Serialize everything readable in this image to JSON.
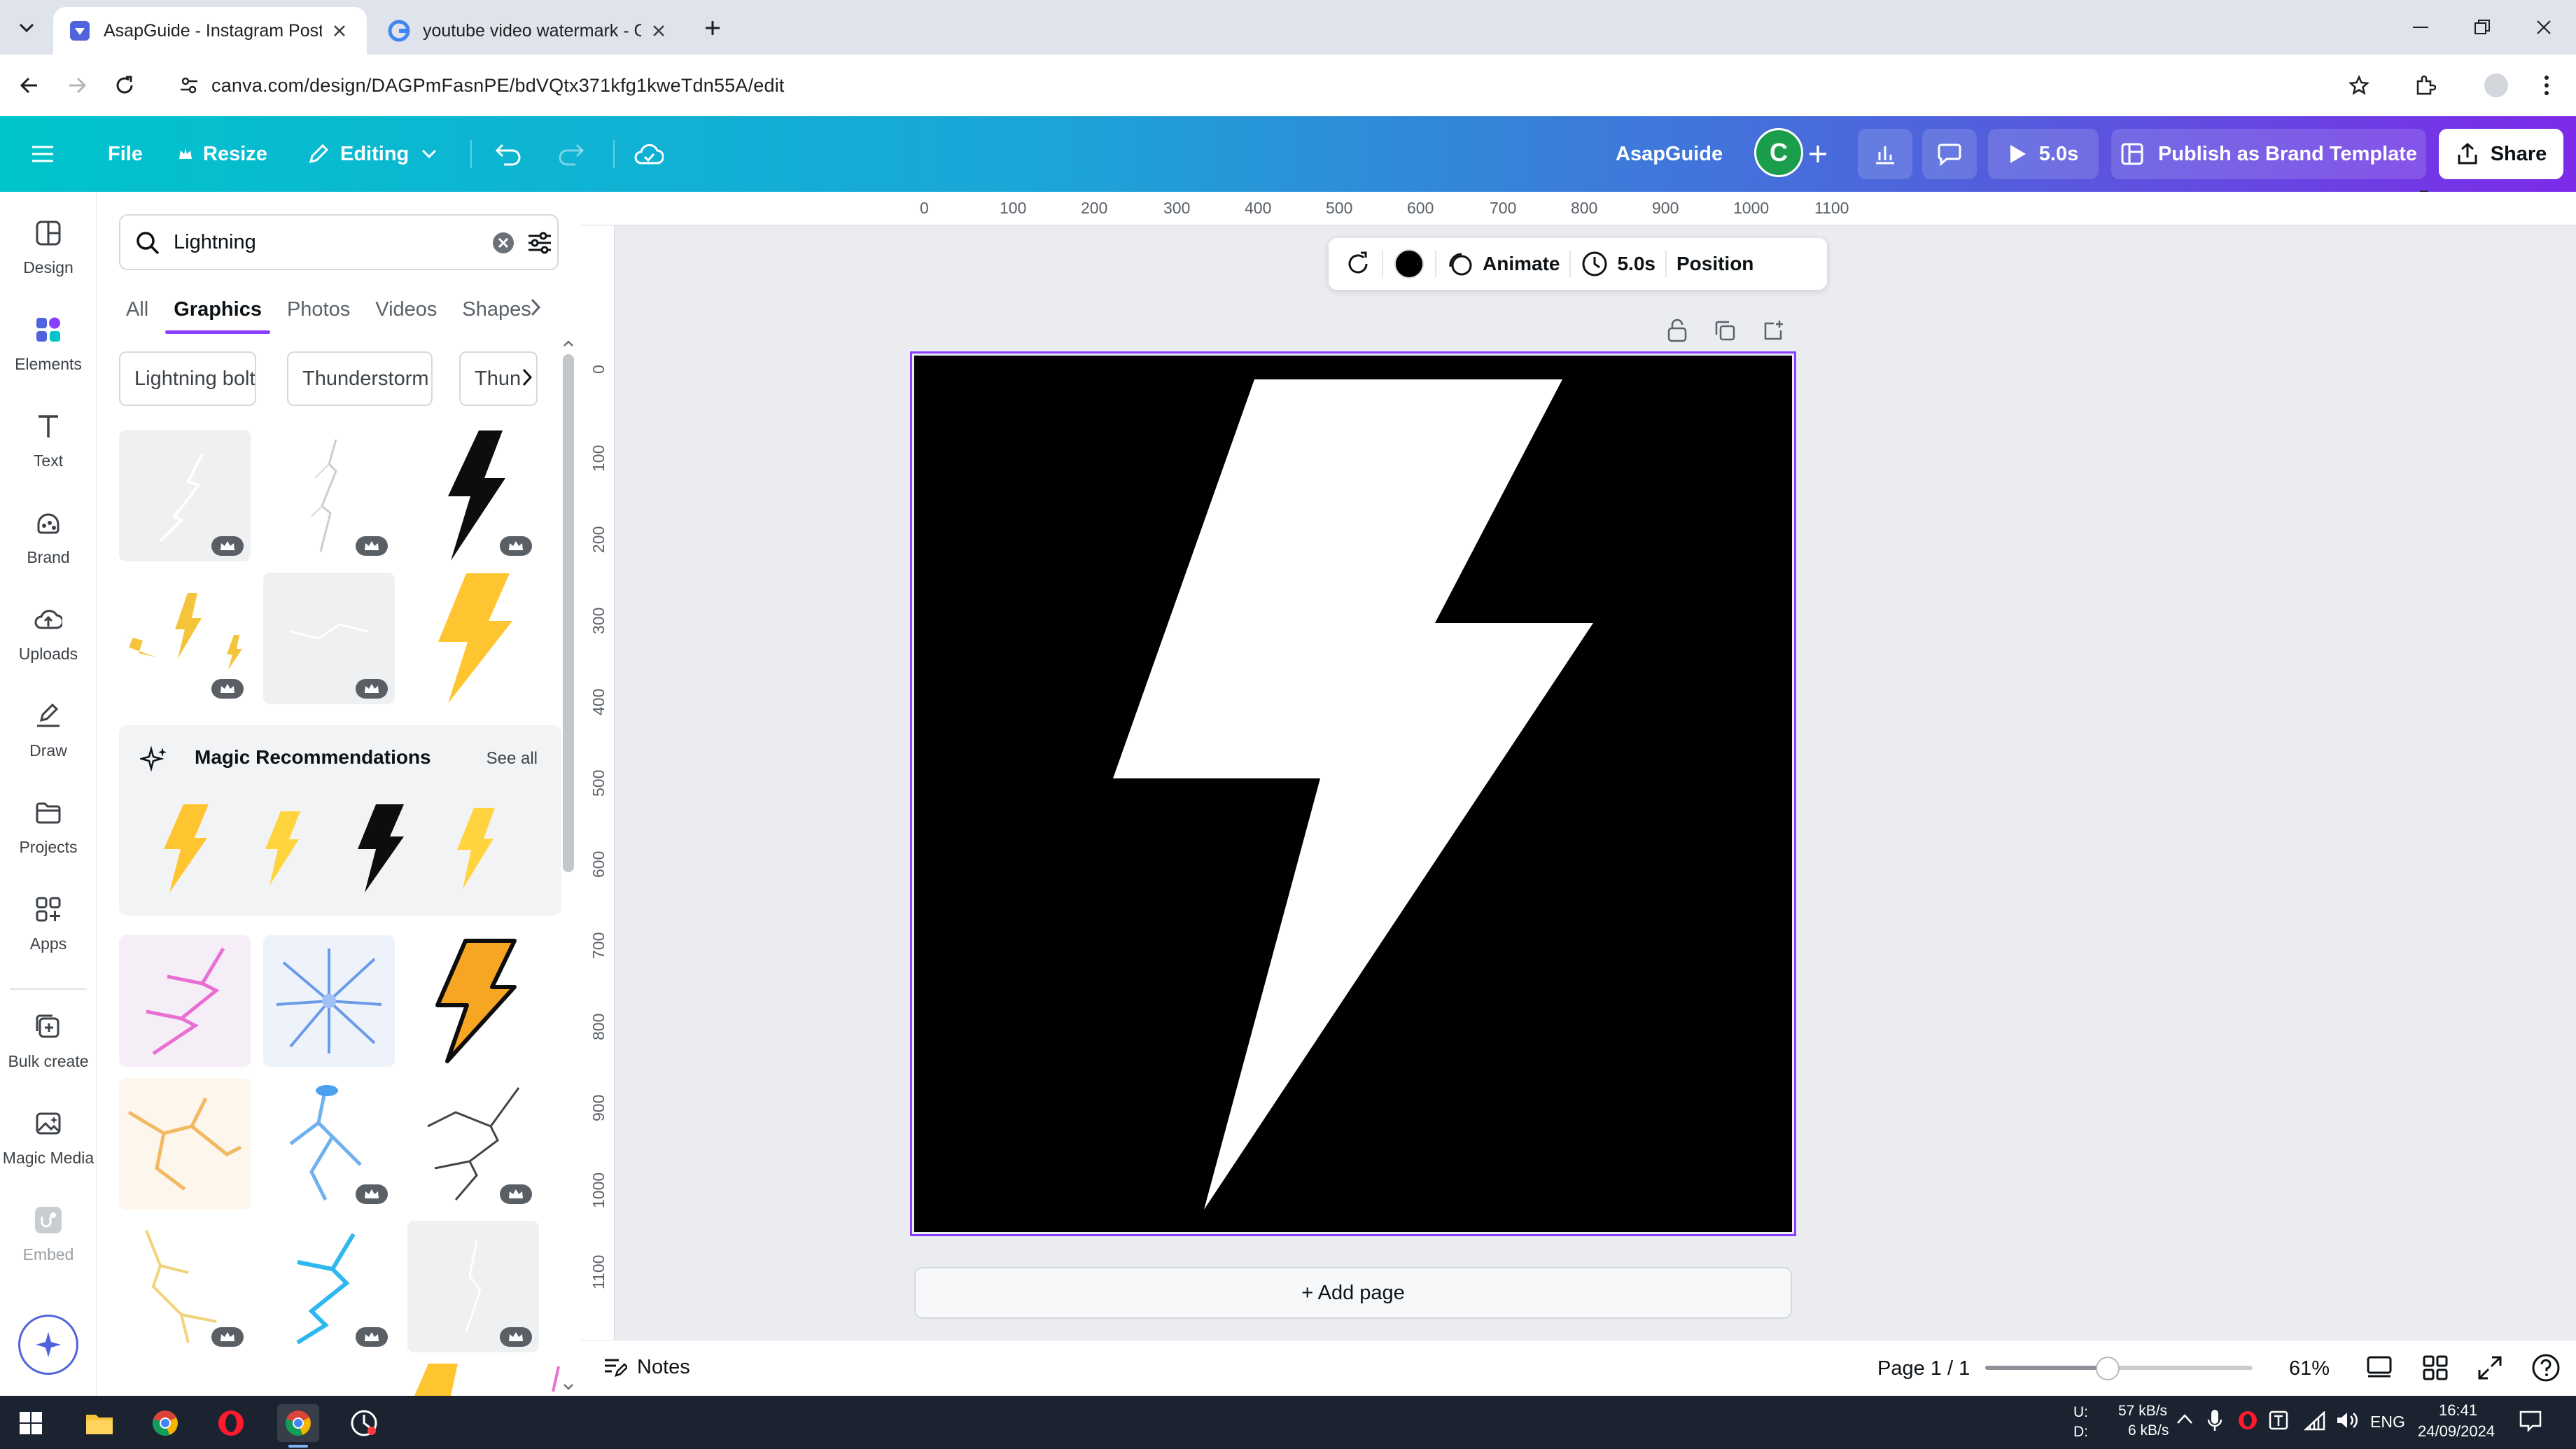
{
  "browser": {
    "tabs": [
      {
        "title": "AsapGuide - Instagram Post - C",
        "active": true,
        "icon": "canva-favicon"
      },
      {
        "title": "youtube video watermark - Go",
        "active": false,
        "icon": "google-favicon"
      }
    ],
    "url": "canva.com/design/DAGPmFasnPE/bdVQtx371kfg1kweTdn55A/edit"
  },
  "header": {
    "file": "File",
    "resize": "Resize",
    "editing": "Editing",
    "brand_name": "AsapGuide",
    "avatar_letter": "C",
    "timer": "5.0s",
    "publish": "Publish as Brand Template",
    "share": "Share"
  },
  "rail": {
    "items": [
      {
        "label": "Design",
        "icon": "design-icon"
      },
      {
        "label": "Elements",
        "icon": "elements-icon"
      },
      {
        "label": "Text",
        "icon": "text-icon"
      },
      {
        "label": "Brand",
        "icon": "brand-icon"
      },
      {
        "label": "Uploads",
        "icon": "uploads-icon"
      },
      {
        "label": "Draw",
        "icon": "draw-icon"
      },
      {
        "label": "Projects",
        "icon": "projects-icon"
      },
      {
        "label": "Apps",
        "icon": "apps-icon"
      },
      {
        "label": "Bulk create",
        "icon": "bulk-create-icon"
      },
      {
        "label": "Magic Media",
        "icon": "magic-media-icon"
      },
      {
        "label": "Embed",
        "icon": "embed-icon"
      }
    ]
  },
  "panel": {
    "search_value": "Lightning",
    "tabs": [
      "All",
      "Graphics",
      "Photos",
      "Videos",
      "Shapes"
    ],
    "active_tab": "Graphics",
    "chips": [
      "Lightning bolt",
      "Thunderstorm",
      "Thun"
    ],
    "magic_title": "Magic Recommendations",
    "see_all": "See all"
  },
  "toolbar": {
    "animate": "Animate",
    "duration": "5.0s",
    "position": "Position",
    "color": "#000000"
  },
  "rulers": {
    "h": [
      "0",
      "100",
      "200",
      "300",
      "400",
      "500",
      "600",
      "700",
      "800",
      "900",
      "1000",
      "1100"
    ],
    "v": [
      "0",
      "100",
      "200",
      "300",
      "400",
      "500",
      "600",
      "700",
      "800",
      "900",
      "1000",
      "1100"
    ]
  },
  "canvas": {
    "background": "#000000",
    "add_page": "+ Add page"
  },
  "footer": {
    "notes": "Notes",
    "page": "Page 1 / 1",
    "zoom": "61%",
    "zoom_level": 0.61
  },
  "taskbar": {
    "net_up": "57 kB/s",
    "net_down": "6 kB/s",
    "up_label": "U:",
    "down_label": "D:",
    "lang": "ENG",
    "time": "16:41",
    "date": "24/09/2024"
  },
  "colors": {
    "accent": "#8b3dff",
    "header_start": "#00c4cc",
    "header_end": "#7d2ae8",
    "bolt_yellow": "#ffc531"
  }
}
